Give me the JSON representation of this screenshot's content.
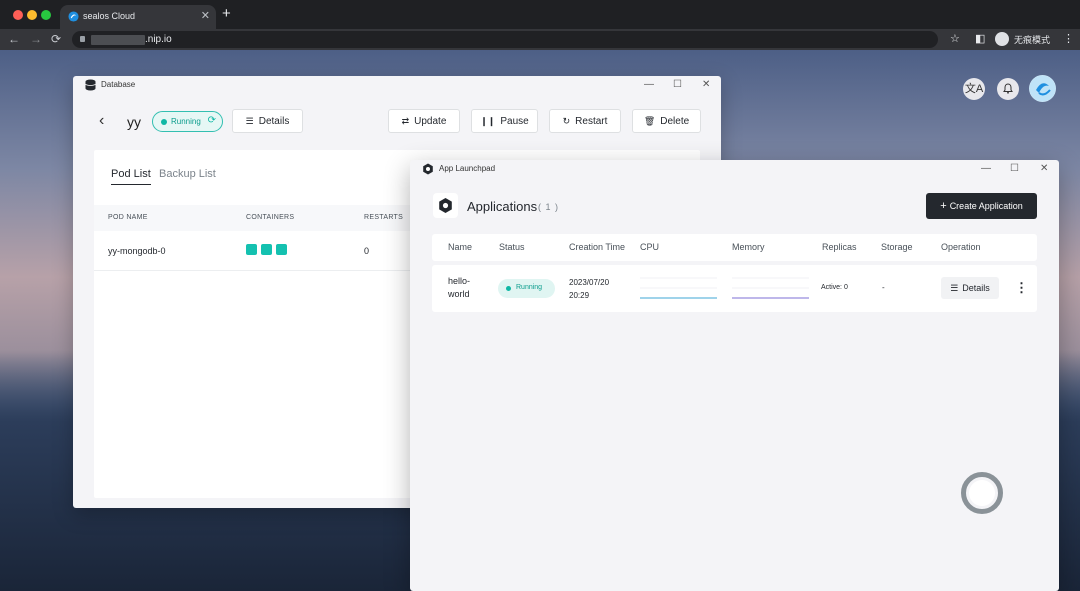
{
  "browser": {
    "tab_title": "sealos Cloud",
    "tab_close": "✕",
    "new_tab": "+",
    "url_suffix": ".nip.io",
    "nav": {
      "back": "←",
      "forward": "→",
      "reload": "⟳"
    },
    "toolbar_icons": {
      "bookmark": "☆",
      "sidebar": "◧",
      "menu": "⋮"
    },
    "profile_label": "无痕模式"
  },
  "desktop": {
    "translate_icon": "文A",
    "bell_icon": "🔔"
  },
  "database_window": {
    "title": "Database",
    "controls": {
      "minimize": "—",
      "maximize": "☐",
      "close": "✕"
    },
    "db_name": "yy",
    "status": "Running",
    "status_spinner": "⟳",
    "buttons": {
      "details": "Details",
      "update": "Update",
      "pause": "Pause",
      "restart": "Restart",
      "delete": "Delete"
    },
    "tabs": [
      "Pod List",
      "Backup List"
    ],
    "pod_columns": [
      "POD NAME",
      "CONTAINERS",
      "RESTARTS"
    ],
    "pods": [
      {
        "name": "yy-mongodb-0",
        "containers": 3,
        "restarts": "0"
      }
    ]
  },
  "launchpad_window": {
    "title": "App Launchpad",
    "controls": {
      "minimize": "—",
      "maximize": "☐",
      "close": "✕"
    },
    "heading": "Applications",
    "count": "( 1 )",
    "create_button": "Create Application",
    "columns": [
      "Name",
      "Status",
      "Creation Time",
      "CPU",
      "Memory",
      "Replicas",
      "Storage",
      "Operation"
    ],
    "apps": [
      {
        "name": "hello-world",
        "status": "Running",
        "creation_time": "2023/07/20 20:29",
        "replicas": "Active: 0",
        "storage": "-",
        "details_label": "Details",
        "more_label": "⋮"
      }
    ]
  },
  "colors": {
    "accent": "#0fb8a5",
    "dark_button": "#24282e"
  }
}
